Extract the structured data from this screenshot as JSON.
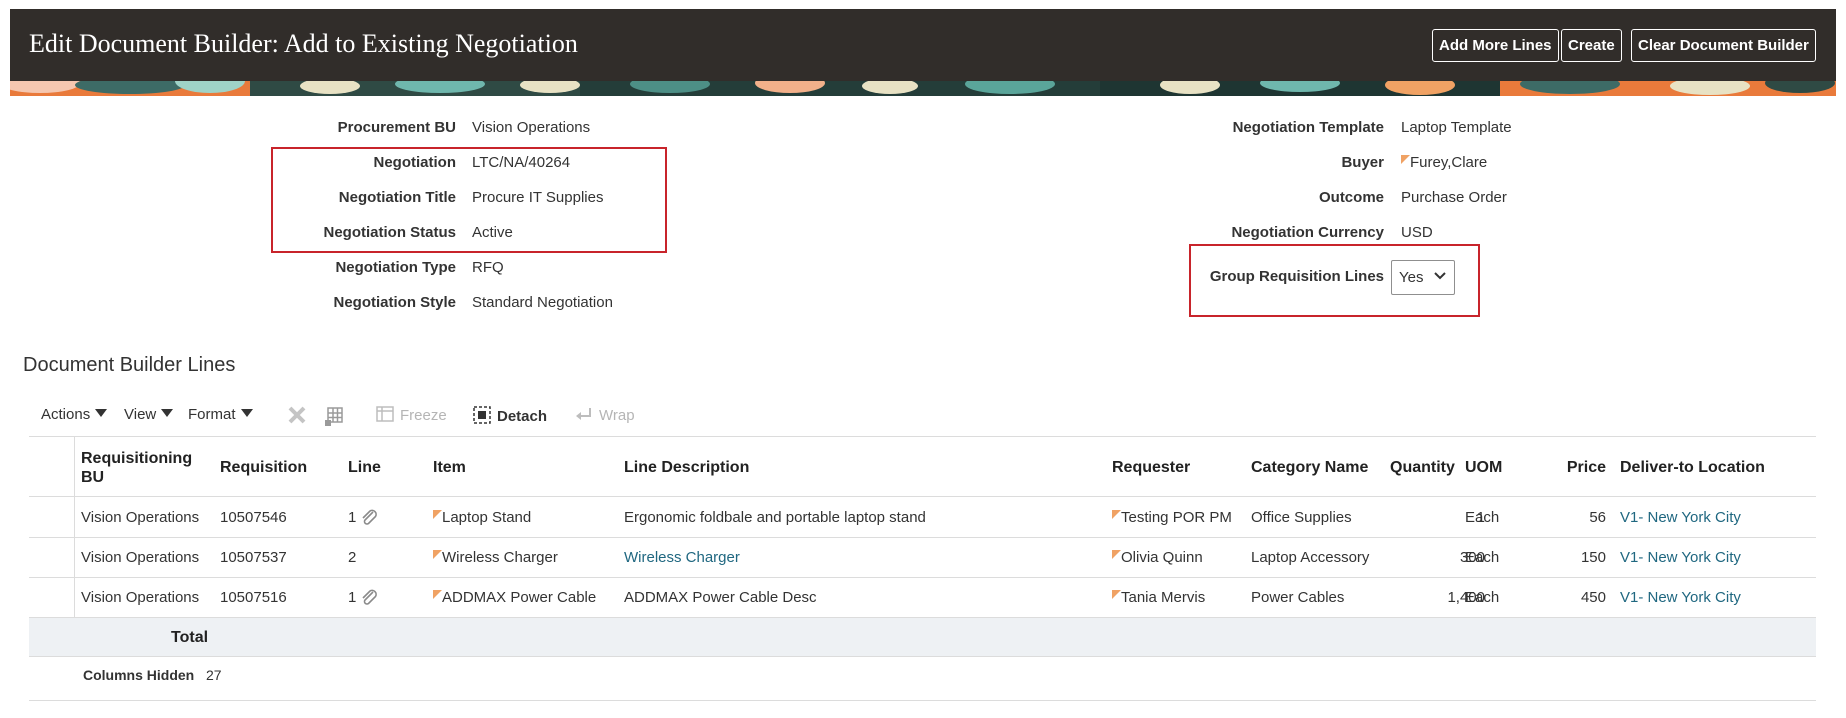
{
  "header": {
    "title": "Edit Document Builder: Add to Existing Negotiation",
    "buttons": {
      "add_more_lines": "Add More Lines",
      "create": "Create",
      "clear": "Clear Document Builder"
    }
  },
  "form": {
    "left": [
      {
        "label": "Procurement BU",
        "value": "Vision Operations"
      },
      {
        "label": "Negotiation",
        "value": "LTC/NA/40264"
      },
      {
        "label": "Negotiation Title",
        "value": "Procure IT Supplies"
      },
      {
        "label": "Negotiation Status",
        "value": "Active"
      },
      {
        "label": "Negotiation Type",
        "value": "RFQ"
      },
      {
        "label": "Negotiation Style",
        "value": "Standard Negotiation"
      }
    ],
    "right": [
      {
        "label": "Negotiation Template",
        "value": "Laptop Template"
      },
      {
        "label": "Buyer",
        "value": "Furey,Clare"
      },
      {
        "label": "Outcome",
        "value": "Purchase Order"
      },
      {
        "label": "Negotiation Currency",
        "value": "USD"
      }
    ],
    "group_requisition_lines": {
      "label": "Group Requisition Lines",
      "value": "Yes"
    }
  },
  "section": {
    "title": "Document Builder Lines"
  },
  "toolbar": {
    "actions": "Actions",
    "view": "View",
    "format": "Format",
    "freeze": "Freeze",
    "detach": "Detach",
    "wrap": "Wrap"
  },
  "table": {
    "columns": {
      "req_bu": "Requisitioning BU",
      "requisition": "Requisition",
      "line": "Line",
      "item": "Item",
      "line_description": "Line Description",
      "requester": "Requester",
      "category": "Category Name",
      "quantity": "Quantity",
      "uom": "UOM",
      "price": "Price",
      "deliver_to": "Deliver-to Location"
    },
    "rows": [
      {
        "req_bu": "Vision Operations",
        "requisition": "10507546",
        "line": "1",
        "attachment": true,
        "item": "Laptop Stand",
        "line_description": "Ergonomic foldbale and portable laptop stand",
        "description_link": false,
        "requester": "Testing POR PM",
        "category": "Office Supplies",
        "quantity": "1",
        "uom": "Each",
        "price": "56",
        "deliver_to": "V1- New York City"
      },
      {
        "req_bu": "Vision Operations",
        "requisition": "10507537",
        "line": "2",
        "attachment": false,
        "item": "Wireless Charger",
        "line_description": "Wireless Charger",
        "description_link": true,
        "requester": "Olivia Quinn",
        "category": "Laptop Accessory",
        "quantity": "300",
        "uom": "Each",
        "price": "150",
        "deliver_to": "V1- New York City"
      },
      {
        "req_bu": "Vision Operations",
        "requisition": "10507516",
        "line": "1",
        "attachment": true,
        "item": "ADDMAX Power Cable",
        "line_description": "ADDMAX Power Cable Desc",
        "description_link": false,
        "requester": "Tania Mervis",
        "category": "Power Cables",
        "quantity": "1,400",
        "uom": "Each",
        "price": "450",
        "deliver_to": "V1- New York City"
      }
    ],
    "total_label": "Total",
    "columns_hidden_label": "Columns Hidden",
    "columns_hidden_count": "27"
  },
  "colors": {
    "header_bg": "#312d2a",
    "highlight_box": "#c8242b",
    "link": "#1f6780",
    "flag": "#f0a264"
  }
}
